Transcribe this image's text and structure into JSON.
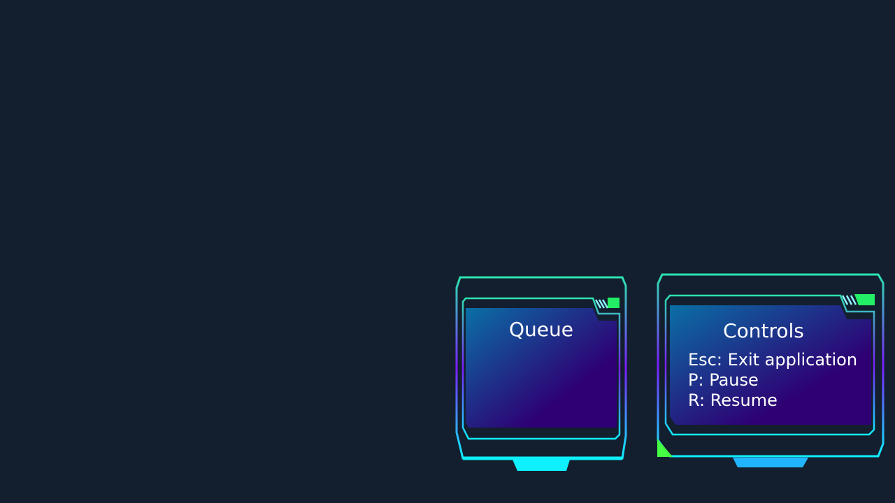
{
  "colors": {
    "background": "#131f2e",
    "frame_teal": "#2de3b0",
    "frame_violet": "#7a1cff",
    "frame_blue": "#22a9ff",
    "frame_cyan": "#0ef0ff",
    "accent_green": "#22ee66",
    "fill_top": "#0a6fa6",
    "fill_bottom": "#2e0073",
    "text": "#ffffff"
  },
  "queue_panel": {
    "title": "Queue"
  },
  "controls_panel": {
    "title": "Controls",
    "items": [
      "Esc: Exit application",
      "P: Pause",
      "R: Resume"
    ]
  }
}
